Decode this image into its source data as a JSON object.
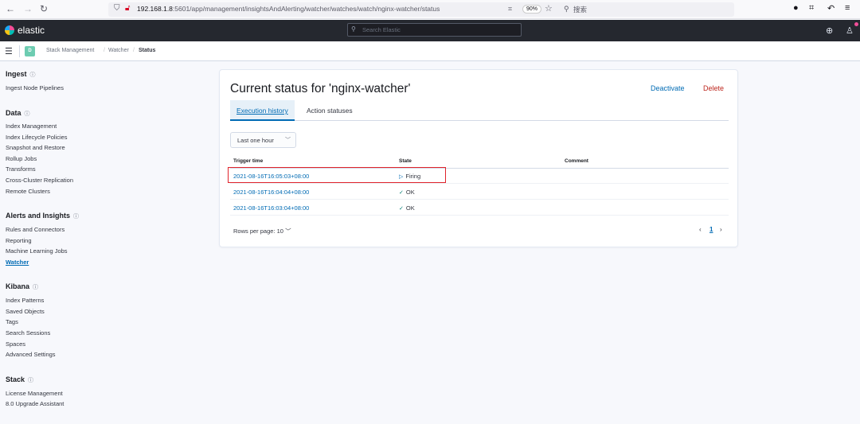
{
  "browser": {
    "url_host": "192.168.1.8",
    "url_path": ":5601/app/management/insightsAndAlerting/watcher/watches/watch/nginx-watcher/status",
    "zoom": "90%",
    "search_label": "搜索"
  },
  "header": {
    "brand": "elastic",
    "search_placeholder": "Search Elastic"
  },
  "breadcrumbs": {
    "space": "D",
    "items": [
      "Stack Management",
      "Watcher",
      "Status"
    ],
    "separator": "/"
  },
  "sidebar": {
    "sections": [
      {
        "title": "Ingest",
        "items": [
          "Ingest Node Pipelines"
        ]
      },
      {
        "title": "Data",
        "items": [
          "Index Management",
          "Index Lifecycle Policies",
          "Snapshot and Restore",
          "Rollup Jobs",
          "Transforms",
          "Cross-Cluster Replication",
          "Remote Clusters"
        ]
      },
      {
        "title": "Alerts and Insights",
        "items": [
          "Rules and Connectors",
          "Reporting",
          "Machine Learning Jobs",
          "Watcher"
        ]
      },
      {
        "title": "Kibana",
        "items": [
          "Index Patterns",
          "Saved Objects",
          "Tags",
          "Search Sessions",
          "Spaces",
          "Advanced Settings"
        ]
      },
      {
        "title": "Stack",
        "items": [
          "License Management",
          "8.0 Upgrade Assistant"
        ]
      }
    ],
    "active_item": "Watcher",
    "help_glyph": "ⓘ"
  },
  "main": {
    "title": "Current status for 'nginx-watcher'",
    "deactivate_label": "Deactivate",
    "delete_label": "Delete",
    "tabs": [
      "Execution history",
      "Action statuses"
    ],
    "time_range": "Last one hour",
    "columns": [
      "Trigger time",
      "State",
      "Comment"
    ],
    "rows": [
      {
        "trigger_time": "2021-08-16T16:05:03+08:00",
        "state": "Firing",
        "state_icon": "play-icon",
        "comment": ""
      },
      {
        "trigger_time": "2021-08-16T16:04:04+08:00",
        "state": "OK",
        "state_icon": "check-icon",
        "comment": ""
      },
      {
        "trigger_time": "2021-08-16T16:03:04+08:00",
        "state": "OK",
        "state_icon": "check-icon",
        "comment": ""
      }
    ],
    "rows_per_page": "Rows per page: 10",
    "current_page": "1"
  },
  "colors": {
    "link": "#006bb4",
    "danger": "#bd271e",
    "highlight": "#e0232b",
    "header_bg": "#25282f"
  }
}
